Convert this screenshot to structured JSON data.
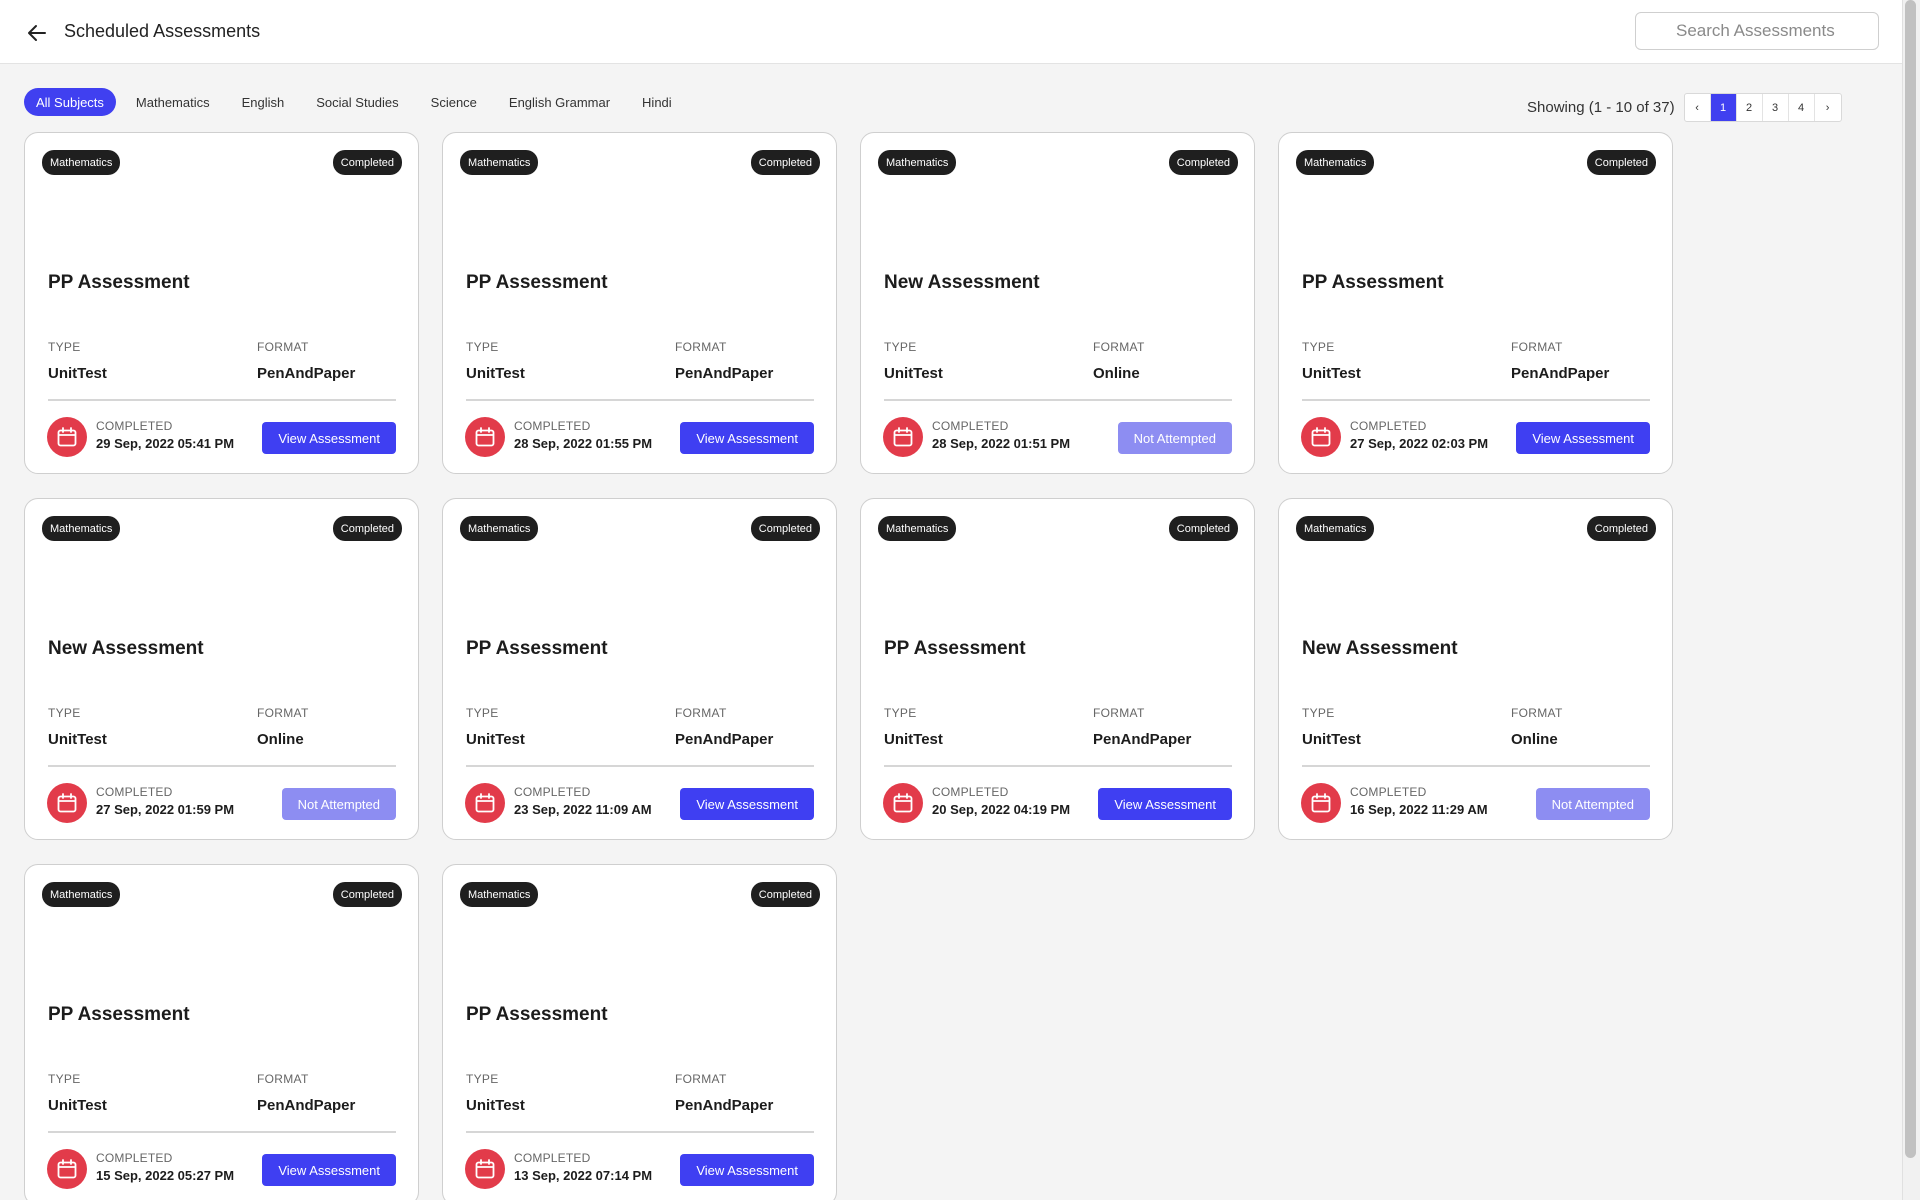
{
  "header": {
    "title": "Scheduled Assessments",
    "search_placeholder": "Search Assessments"
  },
  "filters": [
    {
      "label": "All Subjects",
      "active": true
    },
    {
      "label": "Mathematics",
      "active": false
    },
    {
      "label": "English",
      "active": false
    },
    {
      "label": "Social Studies",
      "active": false
    },
    {
      "label": "Science",
      "active": false
    },
    {
      "label": "English Grammar",
      "active": false
    },
    {
      "label": "Hindi",
      "active": false
    }
  ],
  "pagination": {
    "showing": "Showing (1 - 10 of 37)",
    "prev": "‹",
    "next": "›",
    "pages": [
      "1",
      "2",
      "3",
      "4"
    ],
    "current": "1"
  },
  "labels": {
    "type": "TYPE",
    "format": "FORMAT",
    "completed": "COMPLETED"
  },
  "colors": {
    "accent": "#3f3ff2",
    "accent_disabled": "#8d8df2",
    "calendar_badge": "#e23b4a",
    "badge_bg": "#1f1f1f"
  },
  "cards": [
    {
      "subject": "Mathematics",
      "status": "Completed",
      "title": "PP Assessment",
      "type": "UnitTest",
      "format": "PenAndPaper",
      "date": "29 Sep, 2022 05:41 PM",
      "action": "View Assessment",
      "action_enabled": true
    },
    {
      "subject": "Mathematics",
      "status": "Completed",
      "title": "PP Assessment",
      "type": "UnitTest",
      "format": "PenAndPaper",
      "date": "28 Sep, 2022 01:55 PM",
      "action": "View Assessment",
      "action_enabled": true
    },
    {
      "subject": "Mathematics",
      "status": "Completed",
      "title": "New Assessment",
      "type": "UnitTest",
      "format": "Online",
      "date": "28 Sep, 2022 01:51 PM",
      "action": "Not Attempted",
      "action_enabled": false
    },
    {
      "subject": "Mathematics",
      "status": "Completed",
      "title": "PP Assessment",
      "type": "UnitTest",
      "format": "PenAndPaper",
      "date": "27 Sep, 2022 02:03 PM",
      "action": "View Assessment",
      "action_enabled": true
    },
    {
      "subject": "Mathematics",
      "status": "Completed",
      "title": "New Assessment",
      "type": "UnitTest",
      "format": "Online",
      "date": "27 Sep, 2022 01:59 PM",
      "action": "Not Attempted",
      "action_enabled": false
    },
    {
      "subject": "Mathematics",
      "status": "Completed",
      "title": "PP Assessment",
      "type": "UnitTest",
      "format": "PenAndPaper",
      "date": "23 Sep, 2022 11:09 AM",
      "action": "View Assessment",
      "action_enabled": true
    },
    {
      "subject": "Mathematics",
      "status": "Completed",
      "title": "PP Assessment",
      "type": "UnitTest",
      "format": "PenAndPaper",
      "date": "20 Sep, 2022 04:19 PM",
      "action": "View Assessment",
      "action_enabled": true
    },
    {
      "subject": "Mathematics",
      "status": "Completed",
      "title": "New Assessment",
      "type": "UnitTest",
      "format": "Online",
      "date": "16 Sep, 2022 11:29 AM",
      "action": "Not Attempted",
      "action_enabled": false
    },
    {
      "subject": "Mathematics",
      "status": "Completed",
      "title": "PP Assessment",
      "type": "UnitTest",
      "format": "PenAndPaper",
      "date": "15 Sep, 2022 05:27 PM",
      "action": "View Assessment",
      "action_enabled": true
    },
    {
      "subject": "Mathematics",
      "status": "Completed",
      "title": "PP Assessment",
      "type": "UnitTest",
      "format": "PenAndPaper",
      "date": "13 Sep, 2022 07:14 PM",
      "action": "View Assessment",
      "action_enabled": true
    }
  ]
}
